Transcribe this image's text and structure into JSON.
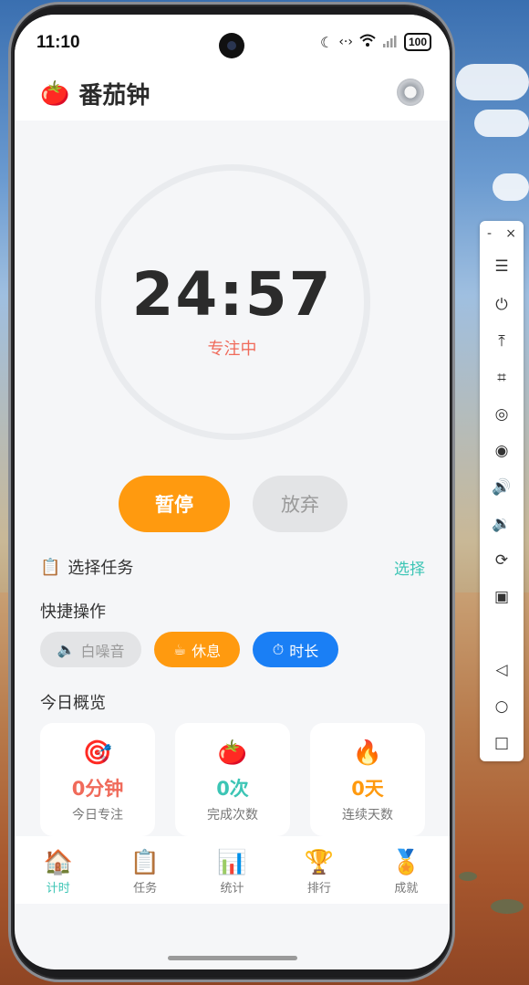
{
  "status_bar": {
    "time": "11:10",
    "battery": "100"
  },
  "header": {
    "title": "番茄钟",
    "logo_icon": "🍅"
  },
  "timer": {
    "value": "24:57",
    "status": "专注中"
  },
  "controls": {
    "pause_label": "暂停",
    "give_up_label": "放弃"
  },
  "task": {
    "label": "选择任务",
    "icon": "📋",
    "action": "选择"
  },
  "quick_actions": {
    "title": "快捷操作",
    "items": [
      {
        "icon": "🔈",
        "label": "白噪音"
      },
      {
        "icon": "☕",
        "label": "休息"
      },
      {
        "icon": "⏱",
        "label": "时长"
      }
    ]
  },
  "overview": {
    "title": "今日概览",
    "cards": [
      {
        "icon": "🎯",
        "value": "0分钟",
        "label": "今日专注",
        "color": "#f06a5a"
      },
      {
        "icon": "🍅",
        "value": "0次",
        "label": "完成次数",
        "color": "#3cc5b5"
      },
      {
        "icon": "🔥",
        "value": "0天",
        "label": "连续天数",
        "color": "#ff9a0f"
      }
    ]
  },
  "tabs": [
    {
      "icon": "🏠",
      "label": "计时"
    },
    {
      "icon": "📋",
      "label": "任务"
    },
    {
      "icon": "📊",
      "label": "统计"
    },
    {
      "icon": "🏆",
      "label": "排行"
    },
    {
      "icon": "🏅",
      "label": "成就"
    }
  ],
  "colors": {
    "accent_orange": "#ff9a0f",
    "accent_teal": "#3cc5b5",
    "accent_blue": "#1a7ff5",
    "accent_red": "#f06a5a"
  },
  "toolbar": {
    "minimize": "-",
    "close": "×"
  }
}
